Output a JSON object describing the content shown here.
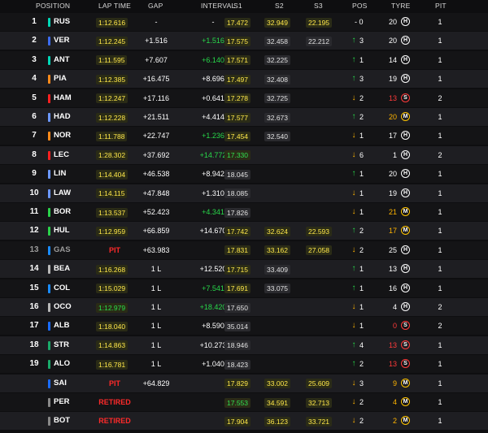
{
  "header": {
    "position": "POSITION",
    "lap_time": "LAP TIME",
    "gap": "GAP",
    "interval": "INTERVAL",
    "s1": "S1",
    "s2": "S2",
    "s3": "S3",
    "pos": "POS",
    "tyre": "TYRE",
    "pit": "PIT"
  },
  "colors": {
    "RUS": "#00d7b6",
    "VER": "#3c6cf0",
    "ANT": "#00d7b6",
    "PIA": "#ff8a1a",
    "HAM": "#ff2020",
    "HAD": "#6c98ff",
    "NOR": "#ff8a1a",
    "LEC": "#ff2020",
    "LIN": "#6c98ff",
    "LAW": "#6c98ff",
    "BOR": "#2ad24a",
    "HUL": "#2ad24a",
    "GAS": "#1a8cff",
    "BEA": "#b8b8b8",
    "COL": "#1a8cff",
    "OCO": "#b8b8b8",
    "ALB": "#1a6cff",
    "STR": "#1aaa6a",
    "ALO": "#1aaa6a",
    "SAI": "#1a6cff",
    "PER": "#888888",
    "BOT": "#888888"
  },
  "rows": [
    {
      "position": "1",
      "code": "RUS",
      "lap": "1:12.616",
      "lap_style": "normal",
      "gap": "-",
      "interval": "-",
      "interval_style": "normal",
      "s1": "17.472",
      "s1_style": "yellow",
      "s2": "32.949",
      "s2_style": "yellow",
      "s3": "22.195",
      "s3_style": "yellow",
      "arrow": "",
      "arrow_style": "",
      "pos_change": "- 0",
      "laps": "20",
      "tyre": "H",
      "tyre_color": "#ffffff",
      "laps_style": "normal",
      "pit": "1"
    },
    {
      "position": "2",
      "code": "VER",
      "lap": "1:12.245",
      "lap_style": "normal",
      "gap": "+1.516",
      "interval": "+1.516",
      "interval_style": "green",
      "s1": "17.575",
      "s1_style": "yellow",
      "s2": "32.458",
      "s2_style": "plain",
      "s3": "22.212",
      "s3_style": "plain",
      "arrow": "↑",
      "arrow_style": "up",
      "pos_change": "3",
      "laps": "20",
      "tyre": "H",
      "tyre_color": "#ffffff",
      "laps_style": "normal",
      "pit": "1"
    },
    {
      "position": "3",
      "code": "ANT",
      "lap": "1:11.595",
      "lap_style": "yellow",
      "gap": "+7.607",
      "interval": "+6.140",
      "interval_style": "green",
      "s1": "17.571",
      "s1_style": "yellow",
      "s2": "32.225",
      "s2_style": "plain",
      "s3": "",
      "s3_style": "none",
      "arrow": "↑",
      "arrow_style": "up",
      "pos_change": "1",
      "laps": "14",
      "tyre": "H",
      "tyre_color": "#ffffff",
      "laps_style": "normal",
      "pit": "1"
    },
    {
      "position": "4",
      "code": "PIA",
      "lap": "1:12.385",
      "lap_style": "normal",
      "gap": "+16.475",
      "interval": "+8.696",
      "interval_style": "normal",
      "s1": "17.497",
      "s1_style": "yellow",
      "s2": "32.408",
      "s2_style": "plain",
      "s3": "",
      "s3_style": "none",
      "arrow": "↑",
      "arrow_style": "up",
      "pos_change": "3",
      "laps": "19",
      "tyre": "H",
      "tyre_color": "#ffffff",
      "laps_style": "normal",
      "pit": "1"
    },
    {
      "position": "5",
      "code": "HAM",
      "lap": "1:12.247",
      "lap_style": "normal",
      "gap": "+17.116",
      "interval": "+0.641",
      "interval_style": "normal",
      "s1": "17.278",
      "s1_style": "yellow",
      "s2": "32.725",
      "s2_style": "plain",
      "s3": "",
      "s3_style": "none",
      "arrow": "↓",
      "arrow_style": "down",
      "pos_change": "2",
      "laps": "13",
      "tyre": "S",
      "tyre_color": "#ff3a3a",
      "laps_style": "red",
      "pit": "2"
    },
    {
      "position": "6",
      "code": "HAD",
      "lap": "1:12.228",
      "lap_style": "normal",
      "gap": "+21.511",
      "interval": "+4.414",
      "interval_style": "normal",
      "s1": "17.577",
      "s1_style": "yellow",
      "s2": "32.673",
      "s2_style": "plain",
      "s3": "",
      "s3_style": "none",
      "arrow": "↑",
      "arrow_style": "up",
      "pos_change": "2",
      "laps": "20",
      "tyre": "M",
      "tyre_color": "#ffc400",
      "laps_style": "orange",
      "pit": "1"
    },
    {
      "position": "7",
      "code": "NOR",
      "lap": "1:11.788",
      "lap_style": "normal",
      "gap": "+22.747",
      "interval": "+1.236",
      "interval_style": "green",
      "s1": "17.454",
      "s1_style": "yellow",
      "s2": "32.540",
      "s2_style": "plain",
      "s3": "",
      "s3_style": "none",
      "arrow": "↓",
      "arrow_style": "down",
      "pos_change": "1",
      "laps": "17",
      "tyre": "H",
      "tyre_color": "#ffffff",
      "laps_style": "normal",
      "pit": "1"
    },
    {
      "position": "8",
      "code": "LEC",
      "lap": "1:28.302",
      "lap_style": "normal",
      "gap": "+37.692",
      "interval": "+14.772",
      "interval_style": "green",
      "s1": "17.330",
      "s1_style": "green",
      "s2": "",
      "s2_style": "none",
      "s3": "",
      "s3_style": "none",
      "arrow": "↓",
      "arrow_style": "down",
      "pos_change": "6",
      "laps": "1",
      "tyre": "H",
      "tyre_color": "#ffffff",
      "laps_style": "normal",
      "pit": "2"
    },
    {
      "position": "9",
      "code": "LIN",
      "lap": "1:14.404",
      "lap_style": "normal",
      "gap": "+46.538",
      "interval": "+8.942",
      "interval_style": "normal",
      "s1": "18.045",
      "s1_style": "plain",
      "s2": "",
      "s2_style": "none",
      "s3": "",
      "s3_style": "none",
      "arrow": "↑",
      "arrow_style": "up",
      "pos_change": "1",
      "laps": "20",
      "tyre": "H",
      "tyre_color": "#ffffff",
      "laps_style": "normal",
      "pit": "1"
    },
    {
      "position": "10",
      "code": "LAW",
      "lap": "1:14.115",
      "lap_style": "normal",
      "gap": "+47.848",
      "interval": "+1.310",
      "interval_style": "normal",
      "s1": "18.085",
      "s1_style": "plain",
      "s2": "",
      "s2_style": "none",
      "s3": "",
      "s3_style": "none",
      "arrow": "↓",
      "arrow_style": "down",
      "pos_change": "1",
      "laps": "19",
      "tyre": "H",
      "tyre_color": "#ffffff",
      "laps_style": "normal",
      "pit": "1"
    },
    {
      "position": "11",
      "code": "BOR",
      "lap": "1:13.537",
      "lap_style": "normal",
      "gap": "+52.423",
      "interval": "+4.341",
      "interval_style": "green",
      "s1": "17.826",
      "s1_style": "plain",
      "s2": "",
      "s2_style": "none",
      "s3": "",
      "s3_style": "none",
      "arrow": "↓",
      "arrow_style": "down",
      "pos_change": "1",
      "laps": "21",
      "tyre": "M",
      "tyre_color": "#ffc400",
      "laps_style": "orange",
      "pit": "1"
    },
    {
      "position": "12",
      "code": "HUL",
      "lap": "1:12.959",
      "lap_style": "normal",
      "gap": "+66.859",
      "interval": "+14.670",
      "interval_style": "normal",
      "s1": "17.742",
      "s1_style": "yellow",
      "s2": "32.624",
      "s2_style": "yellow",
      "s3": "22.593",
      "s3_style": "yellow",
      "arrow": "↑",
      "arrow_style": "up",
      "pos_change": "2",
      "laps": "17",
      "tyre": "M",
      "tyre_color": "#ffc400",
      "laps_style": "orange",
      "pit": "1"
    },
    {
      "position": "13",
      "code": "GAS",
      "lap": "PIT",
      "lap_style": "pit",
      "gap": "+63.983",
      "interval": "",
      "interval_style": "normal",
      "s1": "17.831",
      "s1_style": "yellow",
      "s2": "33.162",
      "s2_style": "yellow",
      "s3": "27.058",
      "s3_style": "yellow",
      "arrow": "↓",
      "arrow_style": "down",
      "pos_change": "2",
      "laps": "25",
      "tyre": "H",
      "tyre_color": "#ffffff",
      "laps_style": "normal",
      "pit": "1",
      "grey": true
    },
    {
      "position": "14",
      "code": "BEA",
      "lap": "1:16.268",
      "lap_style": "normal",
      "gap": "1 L",
      "interval": "+12.520",
      "interval_style": "normal",
      "s1": "17.715",
      "s1_style": "yellow",
      "s2": "33.409",
      "s2_style": "plain",
      "s3": "",
      "s3_style": "none",
      "arrow": "↑",
      "arrow_style": "up",
      "pos_change": "1",
      "laps": "13",
      "tyre": "H",
      "tyre_color": "#ffffff",
      "laps_style": "normal",
      "pit": "1"
    },
    {
      "position": "15",
      "code": "COL",
      "lap": "1:15.029",
      "lap_style": "normal",
      "gap": "1 L",
      "interval": "+7.541",
      "interval_style": "green",
      "s1": "17.691",
      "s1_style": "yellow",
      "s2": "33.075",
      "s2_style": "plain",
      "s3": "",
      "s3_style": "none",
      "arrow": "↑",
      "arrow_style": "up",
      "pos_change": "1",
      "laps": "16",
      "tyre": "H",
      "tyre_color": "#ffffff",
      "laps_style": "normal",
      "pit": "1"
    },
    {
      "position": "16",
      "code": "OCO",
      "lap": "1:12.979",
      "lap_style": "green",
      "gap": "1 L",
      "interval": "+18.420",
      "interval_style": "green",
      "s1": "17.650",
      "s1_style": "plain",
      "s2": "",
      "s2_style": "none",
      "s3": "",
      "s3_style": "none",
      "arrow": "↓",
      "arrow_style": "down",
      "pos_change": "1",
      "laps": "4",
      "tyre": "H",
      "tyre_color": "#ffffff",
      "laps_style": "normal",
      "pit": "2"
    },
    {
      "position": "17",
      "code": "ALB",
      "lap": "1:18.040",
      "lap_style": "normal",
      "gap": "1 L",
      "interval": "+8.590",
      "interval_style": "normal",
      "s1": "35.014",
      "s1_style": "plain",
      "s2": "",
      "s2_style": "none",
      "s3": "",
      "s3_style": "none",
      "arrow": "↓",
      "arrow_style": "down",
      "pos_change": "1",
      "laps": "0",
      "tyre": "S",
      "tyre_color": "#ff3a3a",
      "laps_style": "red",
      "pit": "2"
    },
    {
      "position": "18",
      "code": "STR",
      "lap": "1:14.863",
      "lap_style": "normal",
      "gap": "1 L",
      "interval": "+10.273",
      "interval_style": "normal",
      "s1": "18.946",
      "s1_style": "plain",
      "s2": "",
      "s2_style": "none",
      "s3": "",
      "s3_style": "none",
      "arrow": "↑",
      "arrow_style": "up",
      "pos_change": "4",
      "laps": "13",
      "tyre": "S",
      "tyre_color": "#ff3a3a",
      "laps_style": "red",
      "pit": "1"
    },
    {
      "position": "19",
      "code": "ALO",
      "lap": "1:16.781",
      "lap_style": "normal",
      "gap": "1 L",
      "interval": "+1.040",
      "interval_style": "normal",
      "s1": "18.423",
      "s1_style": "plain",
      "s2": "",
      "s2_style": "none",
      "s3": "",
      "s3_style": "none",
      "arrow": "↑",
      "arrow_style": "up",
      "pos_change": "2",
      "laps": "13",
      "tyre": "S",
      "tyre_color": "#ff3a3a",
      "laps_style": "red",
      "pit": "1"
    },
    {
      "position": "",
      "code": "SAI",
      "lap": "PIT",
      "lap_style": "pit",
      "gap": "+64.829",
      "interval": "",
      "interval_style": "normal",
      "s1": "17.829",
      "s1_style": "yellow",
      "s2": "33.002",
      "s2_style": "yellow",
      "s3": "25.609",
      "s3_style": "yellow",
      "arrow": "↓",
      "arrow_style": "down",
      "pos_change": "3",
      "laps": "9",
      "tyre": "M",
      "tyre_color": "#ffc400",
      "laps_style": "orange",
      "pit": "1"
    },
    {
      "position": "",
      "code": "PER",
      "lap": "RETIRED",
      "lap_style": "pit",
      "gap": "",
      "interval": "",
      "interval_style": "normal",
      "s1": "17.553",
      "s1_style": "green",
      "s2": "34.591",
      "s2_style": "yellow",
      "s3": "32.713",
      "s3_style": "yellow",
      "arrow": "↓",
      "arrow_style": "down",
      "pos_change": "2",
      "laps": "4",
      "tyre": "M",
      "tyre_color": "#ffc400",
      "laps_style": "orange",
      "pit": "1"
    },
    {
      "position": "",
      "code": "BOT",
      "lap": "RETIRED",
      "lap_style": "pit",
      "gap": "",
      "interval": "",
      "interval_style": "normal",
      "s1": "17.904",
      "s1_style": "yellow",
      "s2": "36.123",
      "s2_style": "yellow",
      "s3": "33.721",
      "s3_style": "yellow",
      "arrow": "↓",
      "arrow_style": "down",
      "pos_change": "2",
      "laps": "2",
      "tyre": "M",
      "tyre_color": "#ffc400",
      "laps_style": "orange",
      "pit": "1"
    }
  ]
}
